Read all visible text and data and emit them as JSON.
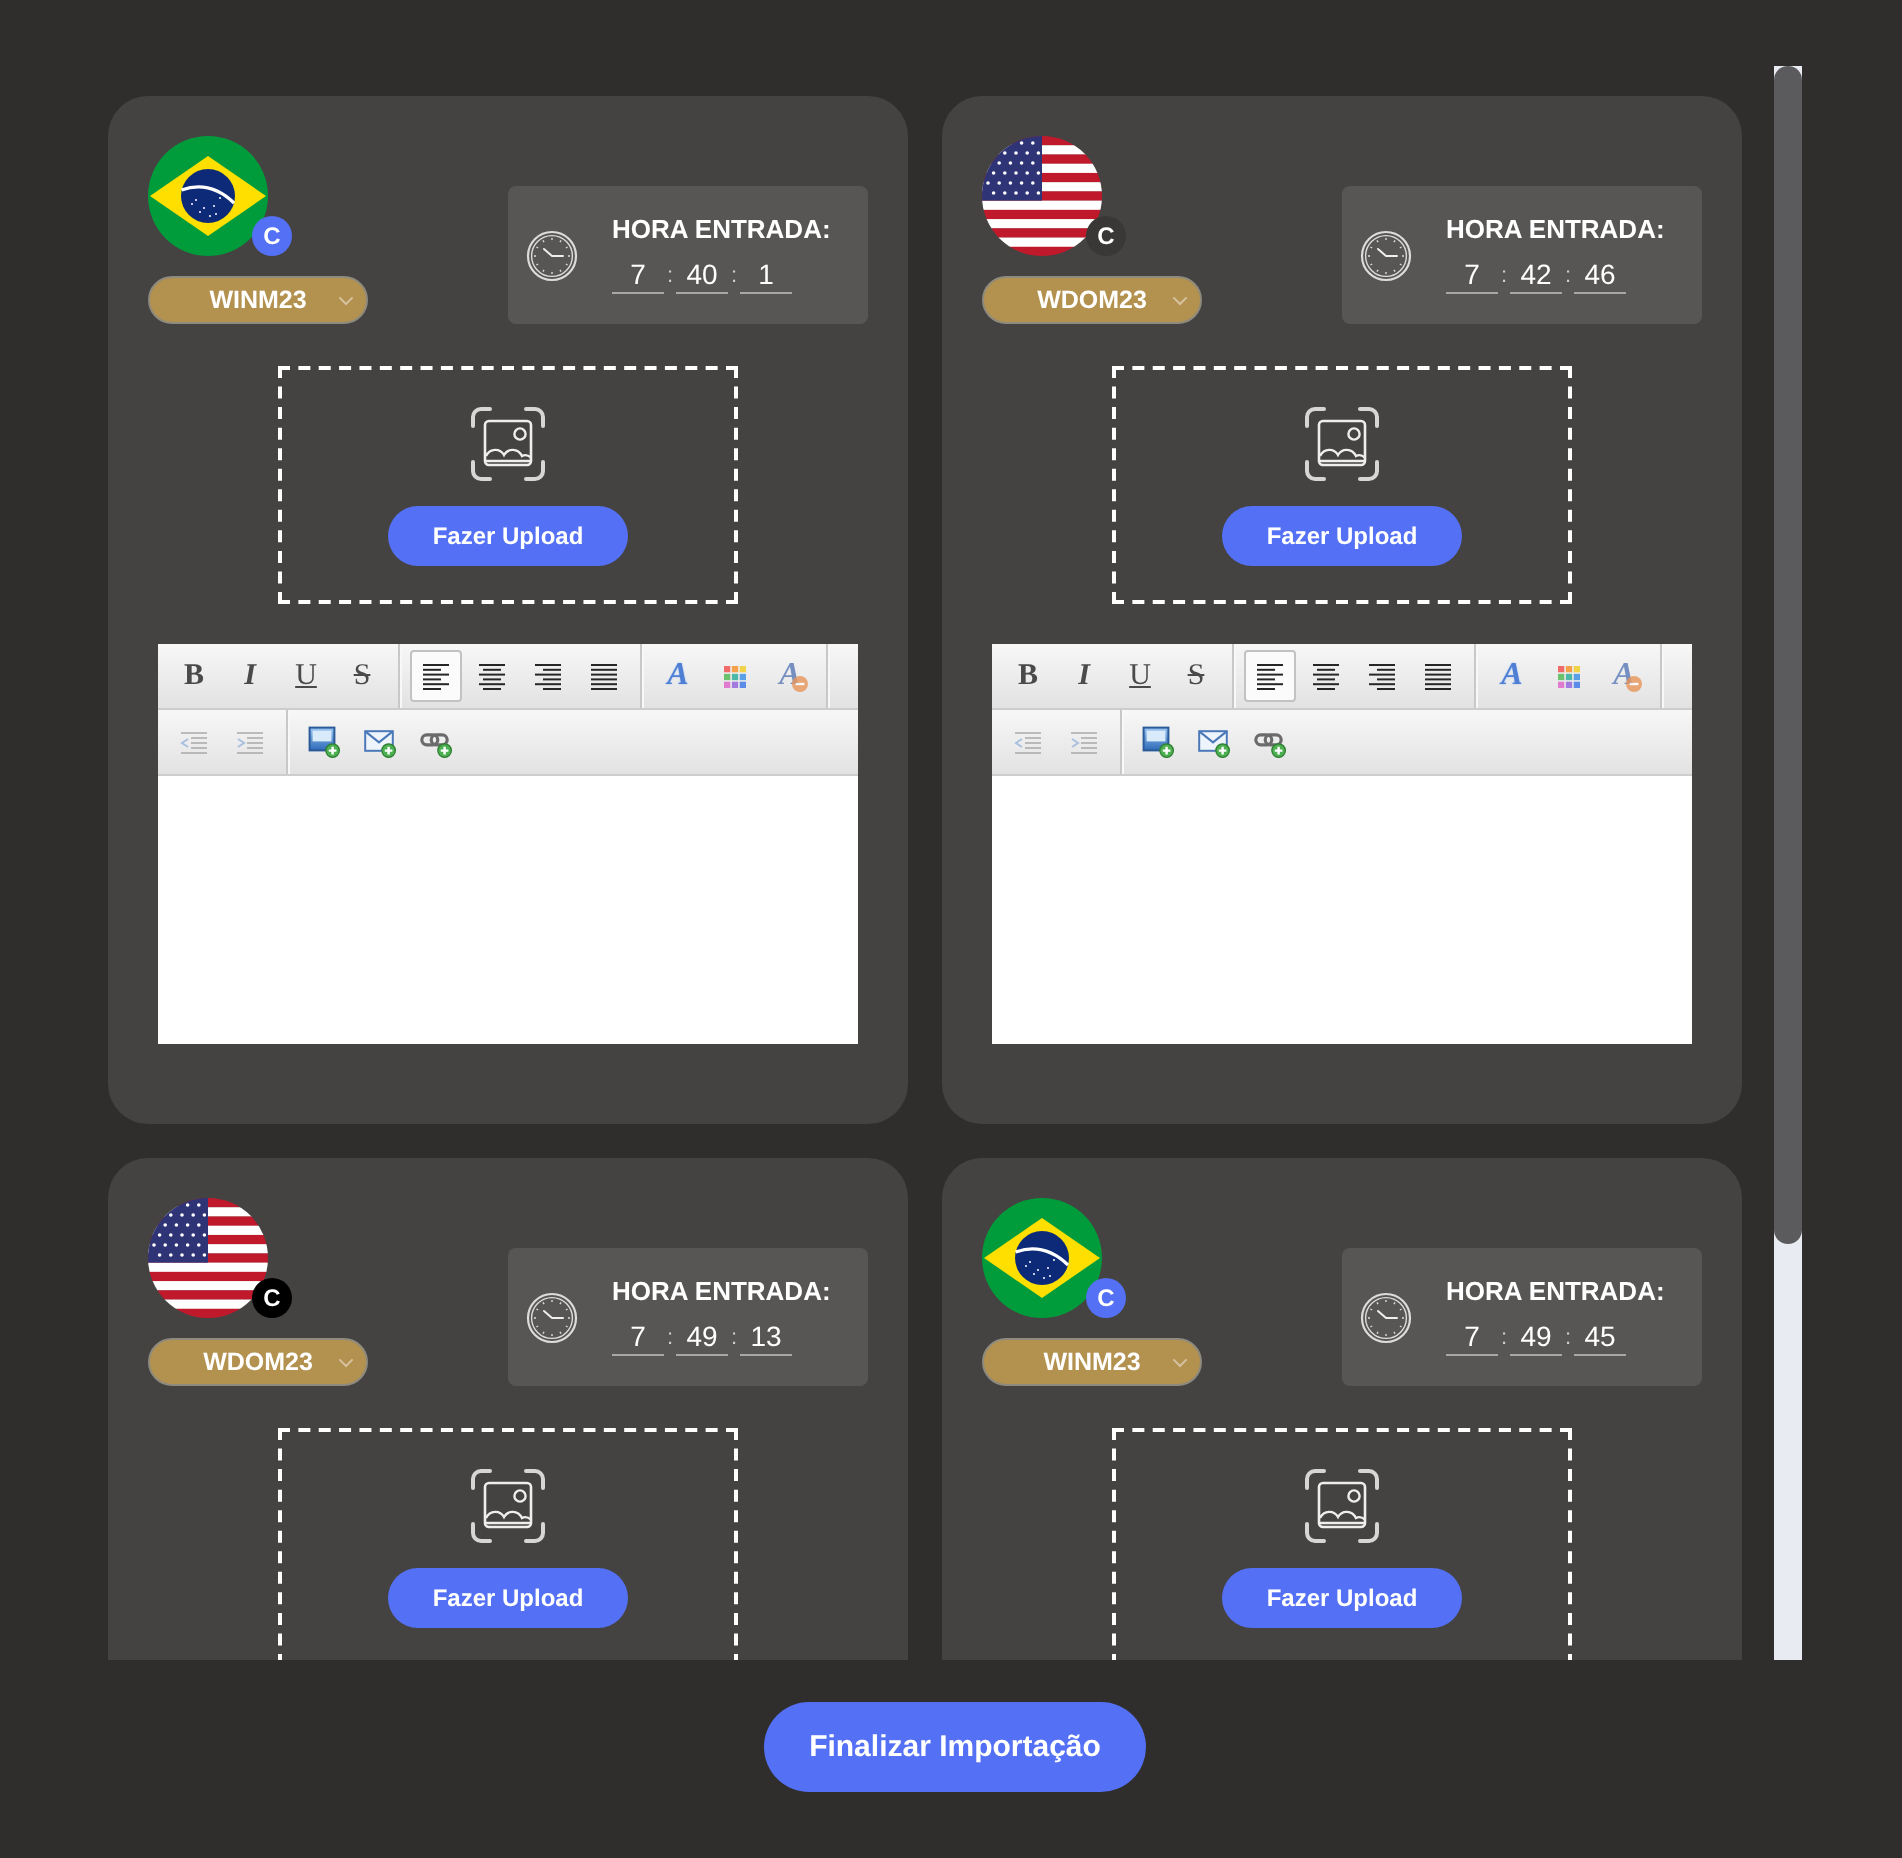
{
  "cards": [
    {
      "flag": {
        "kind": "brazil"
      },
      "badge": {
        "text": "C",
        "color": "#5470f5"
      },
      "symbol": "WINM23",
      "time_label": "HORA ENTRADA:",
      "time_fields": [
        "7",
        "40",
        "1"
      ],
      "time_separators": [
        ":",
        ":"
      ],
      "upload_button": "Fazer Upload",
      "editor": {
        "toolbar_rows": [
          {
            "groups": [
              {
                "items": [
                  {
                    "kind": "bold",
                    "label": "B",
                    "disabled": false
                  },
                  {
                    "kind": "italic",
                    "label": "I",
                    "disabled": false
                  },
                  {
                    "kind": "underline",
                    "label": "U",
                    "disabled": false
                  },
                  {
                    "kind": "strikethrough",
                    "label": "S",
                    "disabled": false
                  }
                ]
              },
              {
                "items": [
                  {
                    "kind": "align-left",
                    "selected": true,
                    "disabled": false
                  },
                  {
                    "kind": "align-center",
                    "selected": false,
                    "disabled": false
                  },
                  {
                    "kind": "align-right",
                    "selected": false,
                    "disabled": false
                  },
                  {
                    "kind": "justify",
                    "selected": false,
                    "disabled": false
                  }
                ]
              },
              {
                "items": [
                  {
                    "kind": "font-color",
                    "label": "A",
                    "disabled": false
                  },
                  {
                    "kind": "background-color",
                    "disabled": false
                  },
                  {
                    "kind": "remove-format",
                    "label": "A",
                    "disabled": true
                  }
                ]
              }
            ]
          },
          {
            "groups": [
              {
                "items": [
                  {
                    "kind": "outdent",
                    "disabled": true
                  },
                  {
                    "kind": "indent",
                    "disabled": true
                  }
                ]
              },
              {
                "items": [
                  {
                    "kind": "insert-image",
                    "disabled": false
                  },
                  {
                    "kind": "insert-email",
                    "disabled": false
                  },
                  {
                    "kind": "insert-link",
                    "disabled": false
                  }
                ]
              }
            ]
          }
        ]
      }
    },
    {
      "flag": {
        "kind": "usa"
      },
      "badge": {
        "text": "C",
        "color": "#3a3836"
      },
      "symbol": "WDOM23",
      "time_label": "HORA ENTRADA:",
      "time_fields": [
        "7",
        "42",
        "46"
      ],
      "time_separators": [
        ":",
        ":"
      ],
      "upload_button": "Fazer Upload",
      "editor": {
        "toolbar_rows": [
          {
            "groups": [
              {
                "items": [
                  {
                    "kind": "bold",
                    "label": "B",
                    "disabled": false
                  },
                  {
                    "kind": "italic",
                    "label": "I",
                    "disabled": false
                  },
                  {
                    "kind": "underline",
                    "label": "U",
                    "disabled": false
                  },
                  {
                    "kind": "strikethrough",
                    "label": "S",
                    "disabled": false
                  }
                ]
              },
              {
                "items": [
                  {
                    "kind": "align-left",
                    "selected": true,
                    "disabled": false
                  },
                  {
                    "kind": "align-center",
                    "selected": false,
                    "disabled": false
                  },
                  {
                    "kind": "align-right",
                    "selected": false,
                    "disabled": false
                  },
                  {
                    "kind": "justify",
                    "selected": false,
                    "disabled": false
                  }
                ]
              },
              {
                "items": [
                  {
                    "kind": "font-color",
                    "label": "A",
                    "disabled": false
                  },
                  {
                    "kind": "background-color",
                    "disabled": false
                  },
                  {
                    "kind": "remove-format",
                    "label": "A",
                    "disabled": true
                  }
                ]
              }
            ]
          },
          {
            "groups": [
              {
                "items": [
                  {
                    "kind": "outdent",
                    "disabled": true
                  },
                  {
                    "kind": "indent",
                    "disabled": true
                  }
                ]
              },
              {
                "items": [
                  {
                    "kind": "insert-image",
                    "disabled": false
                  },
                  {
                    "kind": "insert-email",
                    "disabled": false
                  },
                  {
                    "kind": "insert-link",
                    "disabled": false
                  }
                ]
              }
            ]
          }
        ]
      }
    },
    {
      "flag": {
        "kind": "usa"
      },
      "badge": {
        "text": "C",
        "color": "#000000"
      },
      "symbol": "WDOM23",
      "time_label": "HORA ENTRADA:",
      "time_fields": [
        "7",
        "49",
        "13"
      ],
      "time_separators": [
        ":",
        ":"
      ],
      "upload_button": "Fazer Upload"
    },
    {
      "flag": {
        "kind": "brazil"
      },
      "badge": {
        "text": "C",
        "color": "#5470f5"
      },
      "symbol": "WINM23",
      "time_label": "HORA ENTRADA:",
      "time_fields": [
        "7",
        "49",
        "45"
      ],
      "time_separators": [
        ":",
        ":"
      ],
      "upload_button": "Fazer Upload"
    }
  ],
  "finish_button": "Finalizar Importação"
}
